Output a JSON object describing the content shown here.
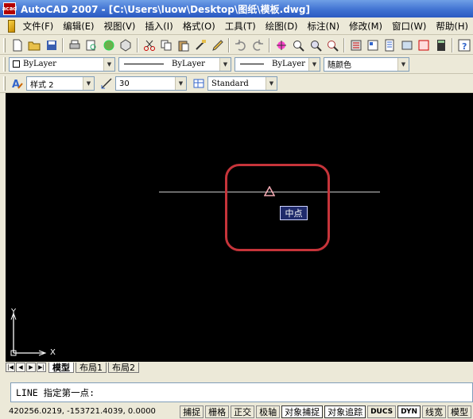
{
  "window": {
    "title": "AutoCAD 2007 - [C:\\Users\\luow\\Desktop\\图纸\\模板.dwg]",
    "logo": "acad"
  },
  "menu": [
    "文件(F)",
    "编辑(E)",
    "视图(V)",
    "插入(I)",
    "格式(O)",
    "工具(T)",
    "绘图(D)",
    "标注(N)",
    "修改(M)",
    "窗口(W)",
    "帮助(H)"
  ],
  "properties": {
    "color": "ByLayer",
    "linetype": "ByLayer",
    "lineweight": "ByLayer",
    "plot_style": "随颜色"
  },
  "styles": {
    "text_style": "样式 2",
    "dim_size": "30",
    "table_style": "Standard"
  },
  "canvas": {
    "snap_tooltip": "中点",
    "ucs_x": "X",
    "ucs_y": "Y",
    "highlight_color": "#c6343a"
  },
  "layout_tabs": [
    "模型",
    "布局1",
    "布局2"
  ],
  "command_line": "LINE 指定第一点:",
  "status": {
    "coordinates": "420256.0219, -153721.4039, 0.0000",
    "toggles": [
      "捕捉",
      "栅格",
      "正交",
      "极轴",
      "对象捕捉",
      "对象追踪",
      "DUCS",
      "DYN",
      "线宽",
      "模型"
    ]
  }
}
